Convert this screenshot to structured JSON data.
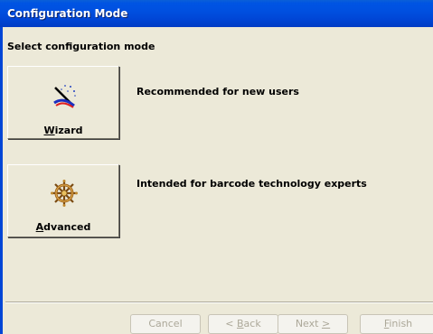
{
  "window": {
    "title": "Configuration Mode"
  },
  "page": {
    "subtitle": "Select configuration mode"
  },
  "modes": [
    {
      "label_mnemonic": "W",
      "label_rest": "izard",
      "description": "Recommended for new users",
      "icon": "wand-icon"
    },
    {
      "label_mnemonic": "A",
      "label_rest": "dvanced",
      "description": "Intended for barcode technology experts",
      "icon": "ship-wheel-icon"
    }
  ],
  "buttons": {
    "cancel": "Cancel",
    "back_prefix": "< ",
    "back_mnemonic": "B",
    "back_rest": "ack",
    "next_prefix": "Next ",
    "next_mnemonic": ">",
    "finish_mnemonic": "F",
    "finish_rest": "inish"
  },
  "colors": {
    "titlebar": "#0054e3",
    "dialog_face": "#ece9d8",
    "disabled_text": "#aca899"
  }
}
